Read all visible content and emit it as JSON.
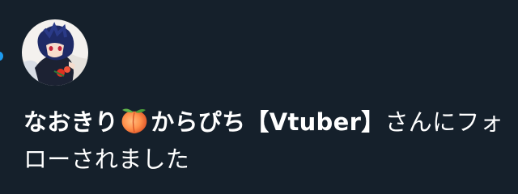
{
  "notification": {
    "type": "follow",
    "sender": {
      "name_part1": "なおきり",
      "name_emoji": "peach-emoji",
      "name_part2": "からぴち【Vtuber】"
    },
    "message": "さんにフォローされました"
  },
  "colors": {
    "background": "#15202b",
    "text": "#ffffff",
    "indicator": "#1d9bf0"
  }
}
